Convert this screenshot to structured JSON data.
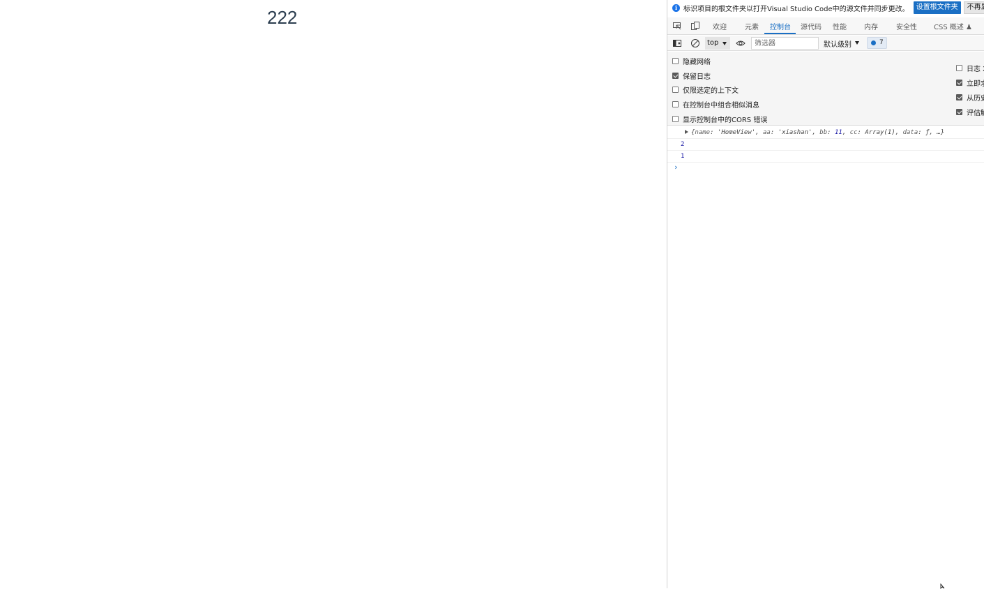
{
  "page": {
    "content": "222"
  },
  "devtools": {
    "infobar": {
      "message": "标识项目的根文件夹以打开Visual Studio Code中的源文件并同步更改。",
      "primary_button": "设置根文件夹",
      "secondary_button": "不再显示"
    },
    "tabs": [
      {
        "label": "欢迎",
        "active": false
      },
      {
        "label": "元素",
        "active": false
      },
      {
        "label": "控制台",
        "active": true
      },
      {
        "label": "源代码",
        "active": false
      },
      {
        "label": "性能",
        "active": false
      },
      {
        "label": "内存",
        "active": false
      },
      {
        "label": "安全性",
        "active": false
      },
      {
        "label": "CSS 概述",
        "active": false
      }
    ],
    "tab_icons": [
      "inspect-icon",
      "device-emulation-icon"
    ],
    "toolbar": {
      "context": "top",
      "filter_placeholder": "筛选器",
      "levels": "默认级别",
      "message_count": "7"
    },
    "settings": {
      "left": [
        {
          "label": "隐藏网络",
          "checked": false
        },
        {
          "label": "保留日志",
          "checked": true
        },
        {
          "label": "仅限选定的上下文",
          "checked": false
        },
        {
          "label": "在控制台中组合相似消息",
          "checked": false
        },
        {
          "label": "显示控制台中的CORS 错误",
          "checked": false
        }
      ],
      "right": [
        {
          "label": "日志 X",
          "checked": false
        },
        {
          "label": "立即求",
          "checked": true
        },
        {
          "label": "从历史",
          "checked": true
        },
        {
          "label": "评估触",
          "checked": true
        }
      ]
    },
    "console": {
      "object_preview": {
        "open": "{",
        "name_key": "name",
        "name_val": "'HomeView'",
        "aa_key": "aa",
        "aa_val": "'xiashan'",
        "bb_key": "bb",
        "bb_val": "11",
        "cc_key": "cc",
        "cc_val": "Array(1)",
        "data_key": "data",
        "data_val": "ƒ",
        "tail": "…}"
      },
      "outputs": [
        "2",
        "1"
      ],
      "prompt": "›"
    }
  }
}
